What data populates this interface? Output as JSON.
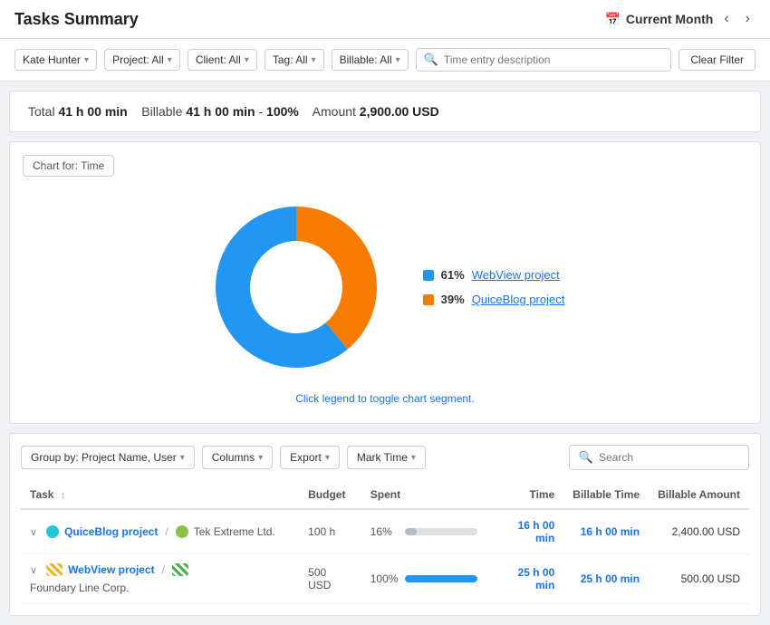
{
  "header": {
    "title": "Tasks Summary",
    "period_icon": "📅",
    "period_label": "Current Month",
    "prev_icon": "‹",
    "next_icon": "›"
  },
  "filters": {
    "user": "Kate Hunter",
    "project": "Project: All",
    "client": "Client: All",
    "tag": "Tag: All",
    "billable": "Billable: All",
    "search_placeholder": "Time entry description",
    "clear_label": "Clear Filter"
  },
  "summary": {
    "total_label": "Total",
    "total_value": "41 h 00 min",
    "billable_label": "Billable",
    "billable_value": "41 h 00 min",
    "billable_pct": "100%",
    "amount_label": "Amount",
    "amount_value": "2,900.00 USD"
  },
  "chart": {
    "chart_for_label": "Chart for: Time",
    "hint": "Click legend to toggle chart segment.",
    "segments": [
      {
        "label": "WebView project",
        "pct": 61,
        "color": "#2196F3"
      },
      {
        "label": "QuiceBlog project",
        "pct": 39,
        "color": "#F57C00"
      }
    ]
  },
  "table_toolbar": {
    "group_by": "Group by: Project Name, User",
    "columns": "Columns",
    "export": "Export",
    "mark_time": "Mark Time",
    "search_placeholder": "Search"
  },
  "table": {
    "columns": [
      "Task",
      "Budget",
      "Spent",
      "Time",
      "Billable Time",
      "Billable Amount"
    ],
    "rows": [
      {
        "expand": "∨",
        "project_color": "#26C6DA",
        "project_stripe": false,
        "project_name": "QuiceBlog project",
        "client_dot_color": "#8BC34A",
        "client_dot_stripe": false,
        "client_name": "Tek Extreme Ltd.",
        "budget": "100 h",
        "spent_pct": 16,
        "spent_color": "#e0e0e0",
        "spent_label": "16%",
        "time": "16 h 00 min",
        "billable_time": "16 h 00 min",
        "billable_amount": "2,400.00 USD"
      },
      {
        "expand": "∨",
        "project_color": null,
        "project_stripe": true,
        "project_stripe_color": "orange",
        "project_name": "WebView project",
        "client_dot_color": null,
        "client_dot_stripe": true,
        "client_dot_stripe_color": "green",
        "client_name": "Foundary Line Corp.",
        "budget": "500 USD",
        "spent_pct": 100,
        "spent_color": "#2196F3",
        "spent_label": "100%",
        "time": "25 h 00 min",
        "billable_time": "25 h 00 min",
        "billable_amount": "500.00 USD"
      }
    ]
  }
}
